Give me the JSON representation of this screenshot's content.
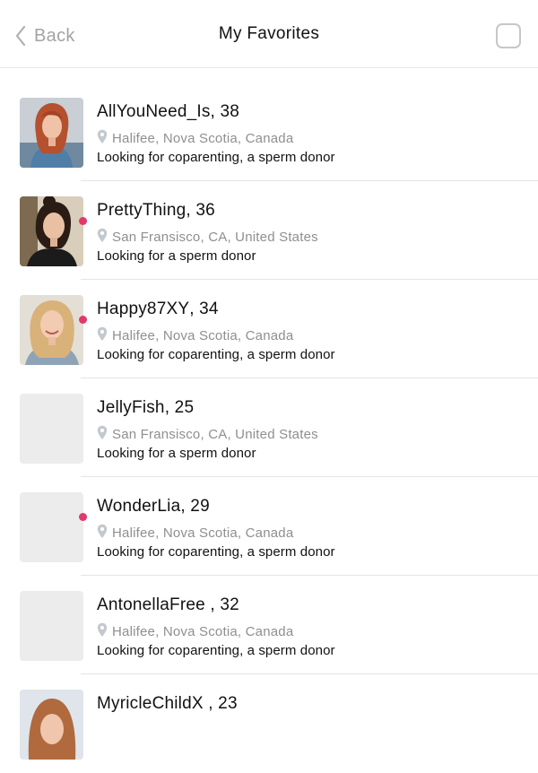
{
  "header": {
    "back_label": "Back",
    "title": "My Favorites"
  },
  "favorites": [
    {
      "username": "AllYouNeed_Is",
      "age_text": ", 38",
      "location": "Halifee, Nova Scotia, Canada",
      "looking_for": "Looking for coparenting, a sperm donor",
      "online": false,
      "photo": "red-hair-woman"
    },
    {
      "username": "PrettyThing",
      "age_text": ", 36",
      "location": "San Fransisco, CA, United States",
      "looking_for": "Looking for a sperm donor",
      "online": true,
      "photo": "dark-hair-woman"
    },
    {
      "username": "Happy87XY",
      "age_text": ", 34",
      "location": "Halifee, Nova Scotia, Canada",
      "looking_for": "Looking for coparenting, a sperm donor",
      "online": true,
      "photo": "blonde-woman"
    },
    {
      "username": "JellyFish",
      "age_text": ", 25",
      "location": "San Fransisco, CA, United States",
      "looking_for": "Looking for a sperm donor",
      "online": false,
      "photo": "placeholder"
    },
    {
      "username": "WonderLia",
      "age_text": ", 29",
      "location": "Halifee, Nova Scotia, Canada",
      "looking_for": "Looking for coparenting, a sperm donor",
      "online": true,
      "photo": "placeholder"
    },
    {
      "username": "AntonellaFree",
      "age_text": " , 32",
      "location": "Halifee, Nova Scotia, Canada",
      "looking_for": "Looking for coparenting, a sperm donor",
      "online": false,
      "photo": "placeholder"
    },
    {
      "username": "MyricleChildX",
      "age_text": " , 23",
      "location": "",
      "looking_for": "",
      "online": false,
      "photo": "auburn-woman"
    }
  ],
  "icons": {
    "back": "chevron-left-icon",
    "select": "checkbox-icon",
    "location": "map-pin-icon"
  },
  "colors": {
    "online_dot": "#e2386a",
    "muted_text": "#8f8f8f",
    "placeholder_avatar": "#ececec"
  }
}
